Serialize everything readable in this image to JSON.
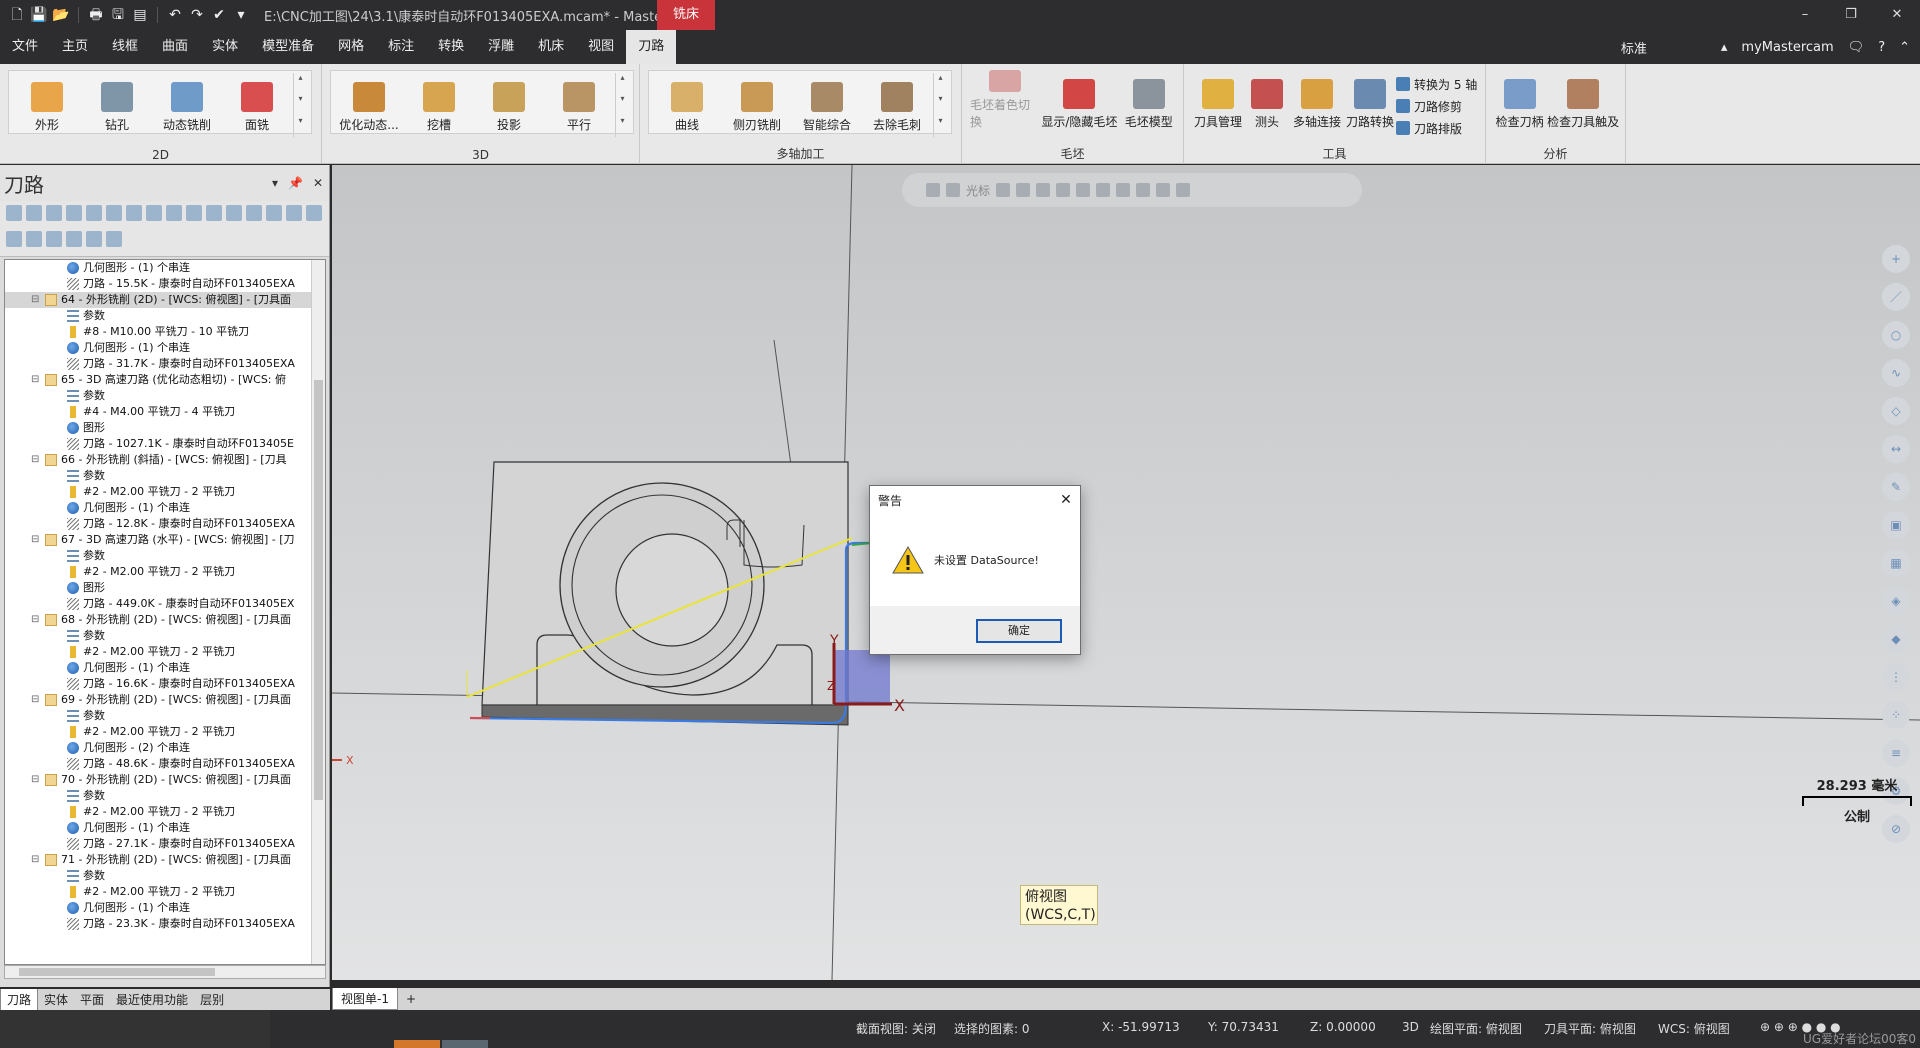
{
  "titlebar": {
    "title": "E:\\CNC加工图\\24\\3.1\\康泰时自动环F013405EXA.mcam* - Masterca...",
    "context_tab": "铣床",
    "min": "–",
    "max": "❐",
    "close": "✕"
  },
  "menu": {
    "tabs": [
      "文件",
      "主页",
      "线框",
      "曲面",
      "实体",
      "模型准备",
      "网格",
      "标注",
      "转换",
      "浮雕",
      "机床",
      "视图",
      "刀路"
    ],
    "right_standard": "标准",
    "right_account": "myMastercam"
  },
  "ribbon": {
    "g2d": {
      "name": "2D",
      "buttons": [
        "外形",
        "钻孔",
        "动态铣削",
        "面铣"
      ]
    },
    "g3d": {
      "name": "3D",
      "buttons": [
        "优化动态...",
        "挖槽",
        "投影",
        "平行"
      ]
    },
    "gmulti": {
      "name": "多轴加工",
      "buttons": [
        "曲线",
        "侧刃铣削",
        "智能综合",
        "去除毛刺"
      ]
    },
    "gstock": {
      "name": "毛坯",
      "buttons": [
        "毛坯着色切换",
        "显示/隐藏毛坯",
        "毛坯模型"
      ]
    },
    "gtools": {
      "name": "工具",
      "buttons": [
        "刀具管理",
        "测头",
        "多轴连接",
        "刀路转换"
      ],
      "small": [
        "转换为 5 轴",
        "刀路修剪",
        "刀路排版"
      ]
    },
    "ganalysis": {
      "name": "分析",
      "buttons": [
        "检查刀柄",
        "检查刀具触及"
      ]
    }
  },
  "leftpanel": {
    "title": "刀路",
    "tree": [
      {
        "indent": 2,
        "icon": "geom",
        "text": "几何图形 - (1) 个串连"
      },
      {
        "indent": 2,
        "icon": "path",
        "text": "刀路 - 15.5K - 康泰时自动环F013405EXA"
      },
      {
        "indent": 1,
        "icon": "folder",
        "text": "64 - 外形铣削 (2D) - [WCS: 俯视图] - [刀具面",
        "sel": true
      },
      {
        "indent": 2,
        "icon": "param",
        "text": "参数"
      },
      {
        "indent": 2,
        "icon": "tool",
        "text": "#8 - M10.00 平铣刀 - 10 平铣刀"
      },
      {
        "indent": 2,
        "icon": "geom",
        "text": "几何图形 - (1) 个串连"
      },
      {
        "indent": 2,
        "icon": "path",
        "text": "刀路 - 31.7K - 康泰时自动环F013405EXA"
      },
      {
        "indent": 1,
        "icon": "folder",
        "text": "65 - 3D 高速刀路 (优化动态粗切) - [WCS: 俯"
      },
      {
        "indent": 2,
        "icon": "param",
        "text": "参数"
      },
      {
        "indent": 2,
        "icon": "tool",
        "text": "#4 - M4.00 平铣刀 - 4 平铣刀"
      },
      {
        "indent": 2,
        "icon": "geom",
        "text": "图形"
      },
      {
        "indent": 2,
        "icon": "path",
        "text": "刀路 - 1027.1K - 康泰时自动环F013405E"
      },
      {
        "indent": 1,
        "icon": "folder",
        "text": "66 - 外形铣削 (斜插) - [WCS: 俯视图] - [刀具"
      },
      {
        "indent": 2,
        "icon": "param",
        "text": "参数"
      },
      {
        "indent": 2,
        "icon": "tool",
        "text": "#2 - M2.00 平铣刀 - 2 平铣刀"
      },
      {
        "indent": 2,
        "icon": "geom",
        "text": "几何图形 - (1) 个串连"
      },
      {
        "indent": 2,
        "icon": "path",
        "text": "刀路 - 12.8K - 康泰时自动环F013405EXA"
      },
      {
        "indent": 1,
        "icon": "folder",
        "text": "67 - 3D 高速刀路 (水平) - [WCS: 俯视图] - [刀"
      },
      {
        "indent": 2,
        "icon": "param",
        "text": "参数"
      },
      {
        "indent": 2,
        "icon": "tool",
        "text": "#2 - M2.00 平铣刀 - 2 平铣刀"
      },
      {
        "indent": 2,
        "icon": "geom",
        "text": "图形"
      },
      {
        "indent": 2,
        "icon": "path",
        "text": "刀路 - 449.0K - 康泰时自动环F013405EX"
      },
      {
        "indent": 1,
        "icon": "folder",
        "text": "68 - 外形铣削 (2D) - [WCS: 俯视图] - [刀具面"
      },
      {
        "indent": 2,
        "icon": "param",
        "text": "参数"
      },
      {
        "indent": 2,
        "icon": "tool",
        "text": "#2 - M2.00 平铣刀 - 2 平铣刀"
      },
      {
        "indent": 2,
        "icon": "geom",
        "text": "几何图形 - (1) 个串连"
      },
      {
        "indent": 2,
        "icon": "path",
        "text": "刀路 - 16.6K - 康泰时自动环F013405EXA"
      },
      {
        "indent": 1,
        "icon": "folder",
        "text": "69 - 外形铣削 (2D) - [WCS: 俯视图] - [刀具面"
      },
      {
        "indent": 2,
        "icon": "param",
        "text": "参数"
      },
      {
        "indent": 2,
        "icon": "tool",
        "text": "#2 - M2.00 平铣刀 - 2 平铣刀"
      },
      {
        "indent": 2,
        "icon": "geom",
        "text": "几何图形 - (2) 个串连"
      },
      {
        "indent": 2,
        "icon": "path",
        "text": "刀路 - 48.6K - 康泰时自动环F013405EXA"
      },
      {
        "indent": 1,
        "icon": "folder",
        "text": "70 - 外形铣削 (2D) - [WCS: 俯视图] - [刀具面"
      },
      {
        "indent": 2,
        "icon": "param",
        "text": "参数"
      },
      {
        "indent": 2,
        "icon": "tool",
        "text": "#2 - M2.00 平铣刀 - 2 平铣刀"
      },
      {
        "indent": 2,
        "icon": "geom",
        "text": "几何图形 - (1) 个串连"
      },
      {
        "indent": 2,
        "icon": "path",
        "text": "刀路 - 27.1K - 康泰时自动环F013405EXA"
      },
      {
        "indent": 1,
        "icon": "folder",
        "text": "71 - 外形铣削 (2D) - [WCS: 俯视图] - [刀具面"
      },
      {
        "indent": 2,
        "icon": "param",
        "text": "参数"
      },
      {
        "indent": 2,
        "icon": "tool",
        "text": "#2 - M2.00 平铣刀 - 2 平铣刀"
      },
      {
        "indent": 2,
        "icon": "geom",
        "text": "几何图形 - (1) 个串连"
      },
      {
        "indent": 2,
        "icon": "path",
        "text": "刀路 - 23.3K - 康泰时自动环F013405EXA"
      }
    ],
    "bottom_tabs": [
      "刀路",
      "实体",
      "平面",
      "最近使用功能",
      "层别"
    ]
  },
  "viewport": {
    "float_label": "光标",
    "view_label_line1": "俯视图",
    "view_label_line2": "(WCS,C,T)",
    "axis_x": "X",
    "axis_y": "Y",
    "axis_z": "Z",
    "scale_value": "28.293 毫米",
    "scale_unit": "公制",
    "tab": "视图单-1",
    "tab_add": "+"
  },
  "dialog": {
    "title": "警告",
    "message": "未设置 DataSource!",
    "ok": "确定"
  },
  "status": {
    "section_view": "截面视图: 关闭",
    "selected": "选择的图素: 0",
    "x": "X:   -51.99713",
    "y": "Y:   70.73431",
    "z": "Z:   0.00000",
    "mode": "3D",
    "draw_plane": "绘图平面: 俯视图",
    "tool_plane": "刀具平面: 俯视图",
    "wcs": "WCS: 俯视图",
    "watermark": "UG爱好者论坛00客0"
  },
  "colors": {
    "accent_tab": "#c8343a",
    "title_bg": "#2d2d30",
    "status_orange": "#d2772c"
  }
}
